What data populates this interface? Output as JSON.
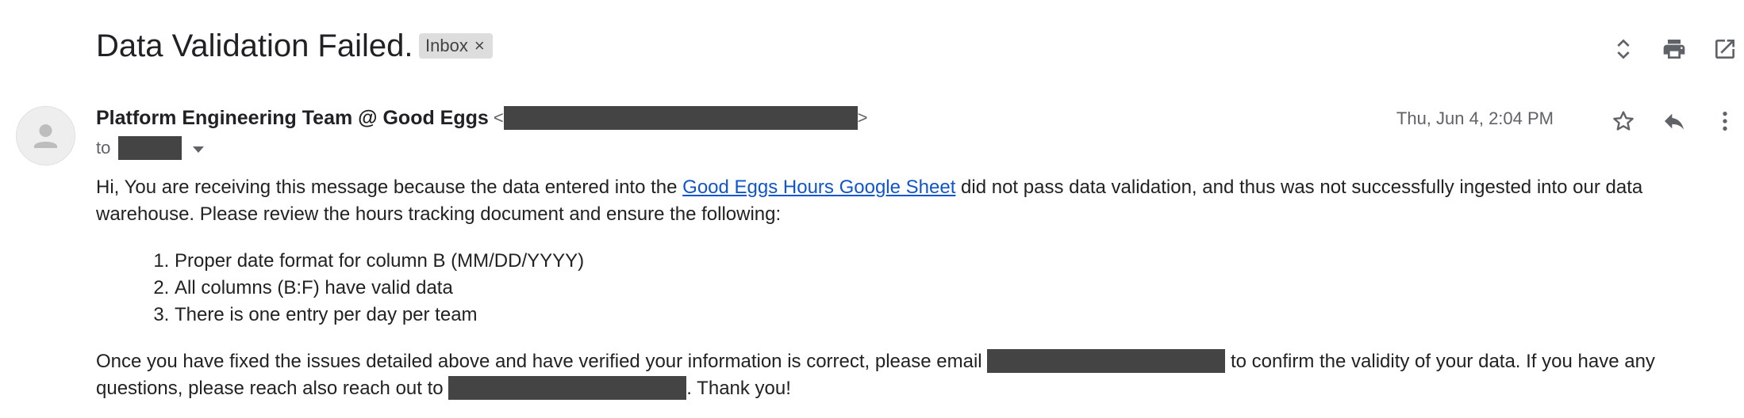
{
  "subject": "Data Validation Failed.",
  "label": {
    "text": "Inbox",
    "remove": "×"
  },
  "toolbar": {
    "icons": [
      "expand-collapse-icon",
      "print-icon",
      "open-in-new-window-icon"
    ]
  },
  "sender": {
    "name": "Platform Engineering Team @ Good Eggs",
    "email_open": "<",
    "email_close": ">",
    "to_prefix": "to"
  },
  "date": "Thu, Jun 4, 2:04 PM",
  "message_actions": {
    "icons": [
      "star-icon",
      "reply-icon",
      "more-options-icon"
    ]
  },
  "body": {
    "intro_before_link": "Hi, You are receiving this message because the data entered into the ",
    "link_text": "Good Eggs Hours Google Sheet",
    "intro_after_link": " did not pass data validation, and thus was not successfully ingested into our data warehouse. Please review the hours tracking document and ensure the following:",
    "list": [
      "Proper date format for column B (MM/DD/YYYY)",
      "All columns (B:F) have valid data",
      "There is one entry per day per team"
    ],
    "closing_part1": "Once you have fixed the issues detailed above and have verified your information is correct, please email ",
    "closing_part2": " to confirm the validity of your data. If you have any questions, please reach also reach out to ",
    "closing_part3": ". Thank you!"
  }
}
